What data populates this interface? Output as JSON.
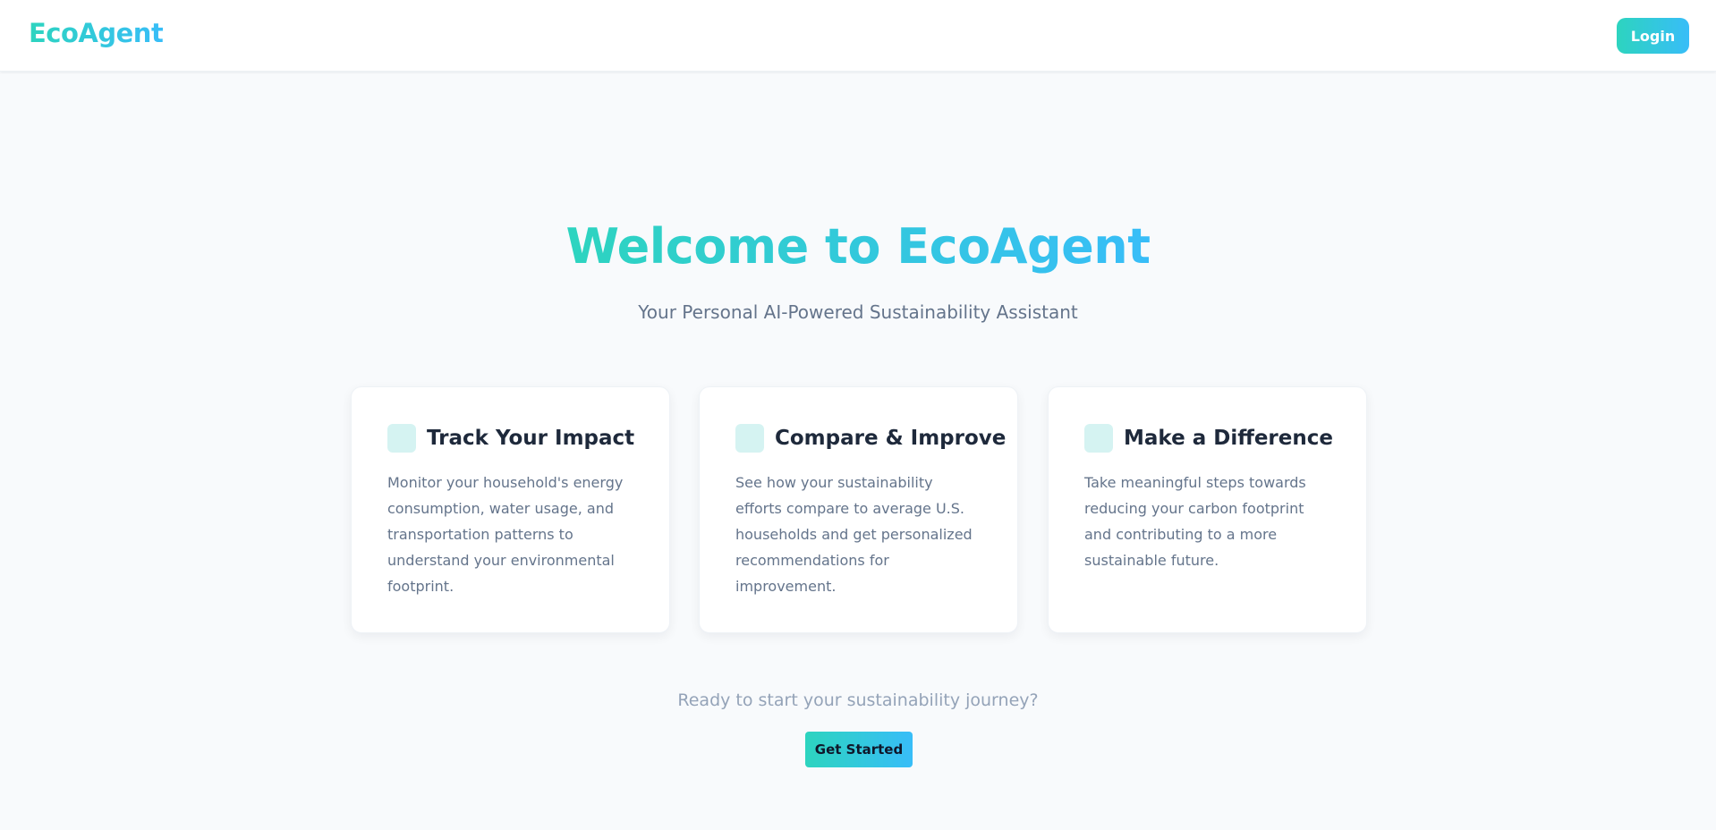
{
  "header": {
    "brand": "EcoAgent",
    "login_label": "Login"
  },
  "hero": {
    "title": "Welcome to EcoAgent",
    "subtitle": "Your Personal AI-Powered Sustainability Assistant"
  },
  "features": [
    {
      "icon": "track-impact-icon",
      "title": "Track Your Impact",
      "text": "Monitor your household's energy consumption, water usage, and transportation patterns to understand your environmental footprint."
    },
    {
      "icon": "compare-improve-icon",
      "title": "Compare & Improve",
      "text": "See how your sustainability efforts compare to average U.S. households and get personalized recommendations for improvement."
    },
    {
      "icon": "make-difference-icon",
      "title": "Make a Difference",
      "text": "Take meaningful steps towards reducing your carbon footprint and contributing to a more sustainable future."
    }
  ],
  "cta": {
    "text": "Ready to start your sustainability journey?",
    "button_label": "Get Started"
  },
  "colors": {
    "accent_start": "#2dd4bf",
    "accent_end": "#38bdf8",
    "icon_bg": "#d5f3f2",
    "page_bg": "#f8fafc"
  }
}
